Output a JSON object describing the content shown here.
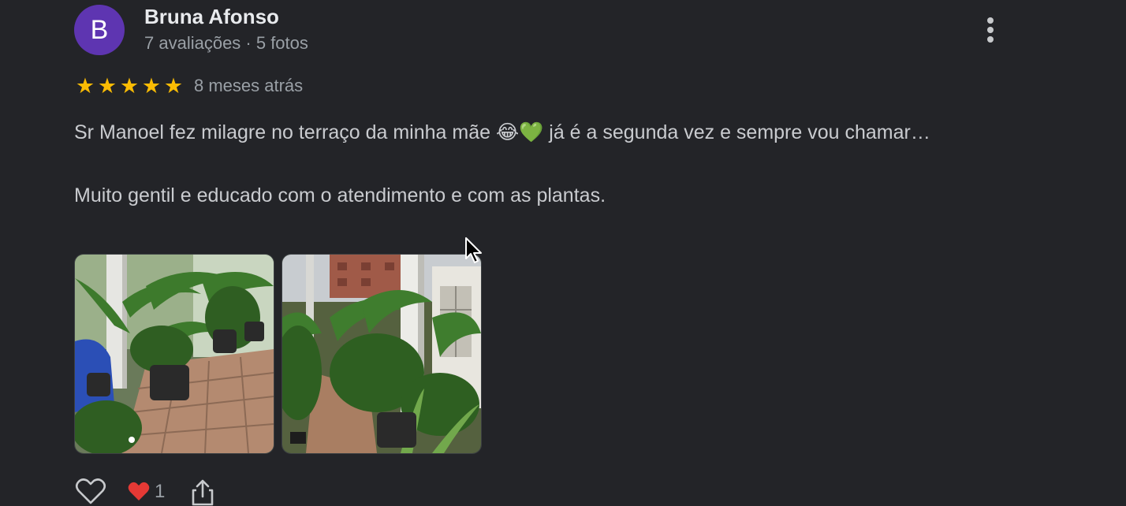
{
  "author": {
    "initial": "B",
    "name": "Bruna Afonso",
    "meta": "7 avaliações · 5 fotos",
    "avatar_color": "#5e35b1"
  },
  "review": {
    "rating": 5,
    "stars": "★★★★★",
    "date": "8 meses atrás",
    "paragraph1": "Sr Manoel fez milagre no terraço da minha mãe 😂💚 já é a segunda vez e sempre vou chamar…",
    "paragraph2": "Muito gentil e educado com o atendimento e com as plantas."
  },
  "photos": [
    {
      "description_icon": "photo-plants-terrace"
    },
    {
      "description_icon": "photo-plants-column"
    }
  ],
  "actions": {
    "like_icon": "heart-outline-icon",
    "reaction_icon": "red-heart-emoji",
    "reaction_emoji": "❤️",
    "reaction_count": "1",
    "share_icon": "share-icon"
  },
  "colors": {
    "background": "#232428",
    "star": "#fbbc04",
    "secondary_text": "#9aa0a6"
  }
}
